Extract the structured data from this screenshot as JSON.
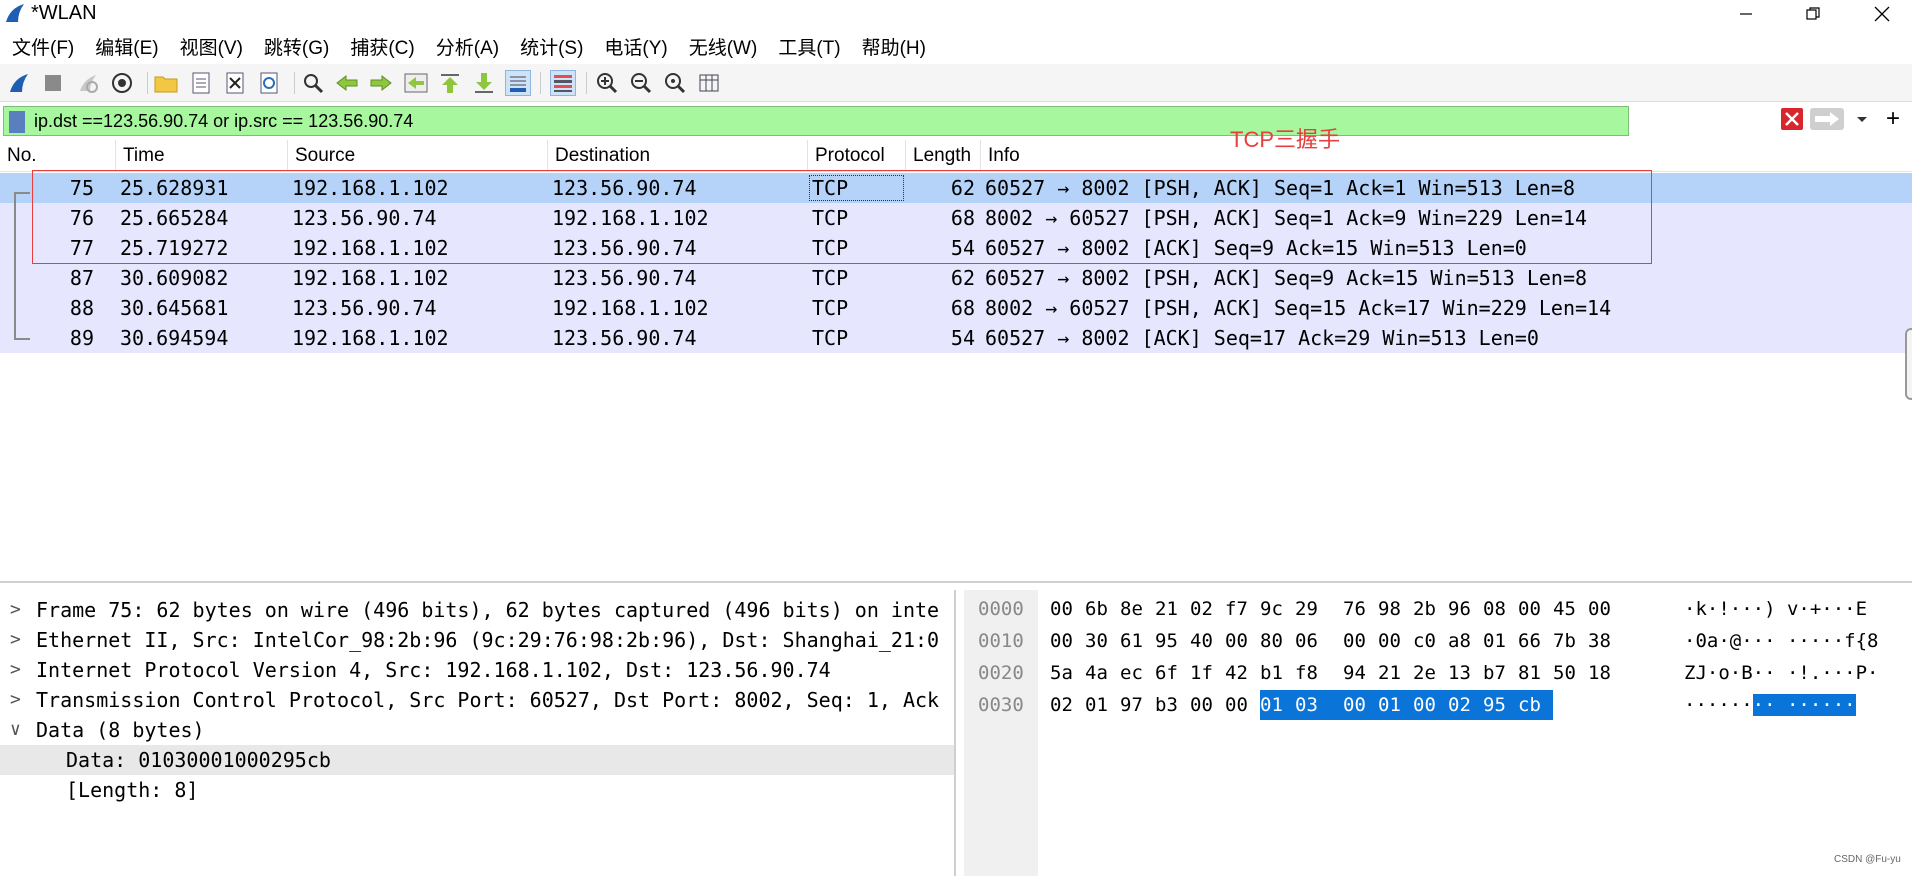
{
  "window": {
    "title": "*WLAN",
    "brand_color": "#1f5fb3"
  },
  "menu": [
    "文件(F)",
    "编辑(E)",
    "视图(V)",
    "跳转(G)",
    "捕获(C)",
    "分析(A)",
    "统计(S)",
    "电话(Y)",
    "无线(W)",
    "工具(T)",
    "帮助(H)"
  ],
  "toolbar": {
    "icons": [
      "shark-fin-start-icon",
      "stop-icon",
      "restart-icon",
      "capture-options-icon",
      "open-folder-icon",
      "open-file-icon",
      "close-file-icon",
      "reload-icon",
      "find-icon",
      "back-icon",
      "forward-icon",
      "go-to-packet-icon",
      "first-packet-icon",
      "last-packet-icon",
      "autoscroll-icon",
      "colorize-icon",
      "zoom-in-icon",
      "zoom-out-icon",
      "normal-size-icon",
      "resize-columns-icon"
    ]
  },
  "filter": {
    "value": "ip.dst ==123.56.90.74 or ip.src == 123.56.90.74",
    "bg_color": "#a6f79d",
    "plus": "+"
  },
  "packet_list": {
    "columns": [
      "No.",
      "Time",
      "Source",
      "Destination",
      "Protocol",
      "Length",
      "Info"
    ],
    "rows": [
      {
        "no": "75",
        "time": "25.628931",
        "source": "192.168.1.102",
        "destination": "123.56.90.74",
        "protocol": "TCP",
        "length": "62",
        "info": "60527 → 8002 [PSH, ACK] Seq=1 Ack=1 Win=513 Len=8"
      },
      {
        "no": "76",
        "time": "25.665284",
        "source": "123.56.90.74",
        "destination": "192.168.1.102",
        "protocol": "TCP",
        "length": "68",
        "info": "8002 → 60527 [PSH, ACK] Seq=1 Ack=9 Win=229 Len=14"
      },
      {
        "no": "77",
        "time": "25.719272",
        "source": "192.168.1.102",
        "destination": "123.56.90.74",
        "protocol": "TCP",
        "length": "54",
        "info": "60527 → 8002 [ACK] Seq=9 Ack=15 Win=513 Len=0"
      },
      {
        "no": "87",
        "time": "30.609082",
        "source": "192.168.1.102",
        "destination": "123.56.90.74",
        "protocol": "TCP",
        "length": "62",
        "info": "60527 → 8002 [PSH, ACK] Seq=9 Ack=15 Win=513 Len=8"
      },
      {
        "no": "88",
        "time": "30.645681",
        "source": "123.56.90.74",
        "destination": "192.168.1.102",
        "protocol": "TCP",
        "length": "68",
        "info": "8002 → 60527 [PSH, ACK] Seq=15 Ack=17 Win=229 Len=14"
      },
      {
        "no": "89",
        "time": "30.694594",
        "source": "192.168.1.102",
        "destination": "123.56.90.74",
        "protocol": "TCP",
        "length": "54",
        "info": "60527 → 8002 [ACK] Seq=17 Ack=29 Win=513 Len=0"
      }
    ],
    "row_color": "#e7e6ff",
    "selected_color": "#b5d2f9"
  },
  "annotation": {
    "label": "TCP三握手",
    "color": "#e83e3e"
  },
  "details": {
    "rows": [
      {
        "arrow": ">",
        "text": "Frame 75: 62 bytes on wire (496 bits), 62 bytes captured (496 bits) on inte"
      },
      {
        "arrow": ">",
        "text": "Ethernet II, Src: IntelCor_98:2b:96 (9c:29:76:98:2b:96), Dst: Shanghai_21:0"
      },
      {
        "arrow": ">",
        "text": "Internet Protocol Version 4, Src: 192.168.1.102, Dst: 123.56.90.74"
      },
      {
        "arrow": ">",
        "text": "Transmission Control Protocol, Src Port: 60527, Dst Port: 8002, Seq: 1, Ack"
      },
      {
        "arrow": "∨",
        "text": "Data (8 bytes)"
      },
      {
        "arrow": "",
        "text": "Data: 01030001000295cb"
      },
      {
        "arrow": "",
        "text": "[Length: 8]"
      }
    ]
  },
  "bytes": {
    "rows": [
      {
        "offset": "0000",
        "hex": [
          "00",
          "6b",
          "8e",
          "21",
          "02",
          "f7",
          "9c",
          "29",
          "76",
          "98",
          "2b",
          "96",
          "08",
          "00",
          "45",
          "00"
        ],
        "ascii": "·k·!···)  v·+···E"
      },
      {
        "offset": "0010",
        "hex": [
          "00",
          "30",
          "61",
          "95",
          "40",
          "00",
          "80",
          "06",
          "00",
          "00",
          "c0",
          "a8",
          "01",
          "66",
          "7b",
          "38"
        ],
        "ascii": "·0a·@···  ·····f{8"
      },
      {
        "offset": "0020",
        "hex": [
          "5a",
          "4a",
          "ec",
          "6f",
          "1f",
          "42",
          "b1",
          "f8",
          "94",
          "21",
          "2e",
          "13",
          "b7",
          "81",
          "50",
          "18"
        ],
        "ascii": "ZJ·o·B··  ·!.···P·"
      },
      {
        "offset": "0030",
        "hex": [
          "02",
          "01",
          "97",
          "b3",
          "00",
          "00",
          "01",
          "03",
          "00",
          "01",
          "00",
          "02",
          "95",
          "cb"
        ],
        "ascii_plain": "······",
        "ascii_hl": "·· ······"
      }
    ],
    "highlight_color": "#0a74d8"
  },
  "watermark": "CSDN @Fu-yu"
}
